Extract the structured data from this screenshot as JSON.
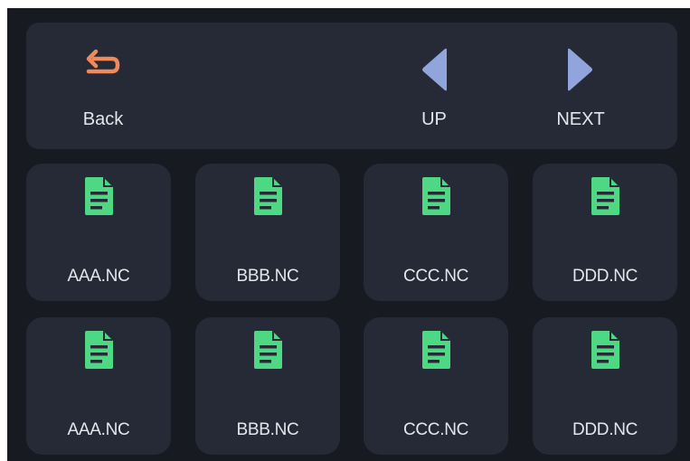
{
  "toolbar": {
    "back": {
      "label": "Back",
      "icon": "return-arrow-icon"
    },
    "up": {
      "label": "UP",
      "icon": "triangle-left-icon"
    },
    "next": {
      "label": "NEXT",
      "icon": "triangle-right-icon"
    }
  },
  "colors": {
    "screen_bg": "#171a20",
    "panel_bg": "#262a36",
    "back_icon": "#f08a5c",
    "nav_icon": "#8fa5dc",
    "file_icon": "#4ed884",
    "text": "#e4e6ec"
  },
  "files": [
    {
      "name": "AAA.NC",
      "icon": "file-document-icon"
    },
    {
      "name": "BBB.NC",
      "icon": "file-document-icon"
    },
    {
      "name": "CCC.NC",
      "icon": "file-document-icon"
    },
    {
      "name": "DDD.NC",
      "icon": "file-document-icon"
    },
    {
      "name": "AAA.NC",
      "icon": "file-document-icon"
    },
    {
      "name": "BBB.NC",
      "icon": "file-document-icon"
    },
    {
      "name": "CCC.NC",
      "icon": "file-document-icon"
    },
    {
      "name": "DDD.NC",
      "icon": "file-document-icon"
    }
  ]
}
